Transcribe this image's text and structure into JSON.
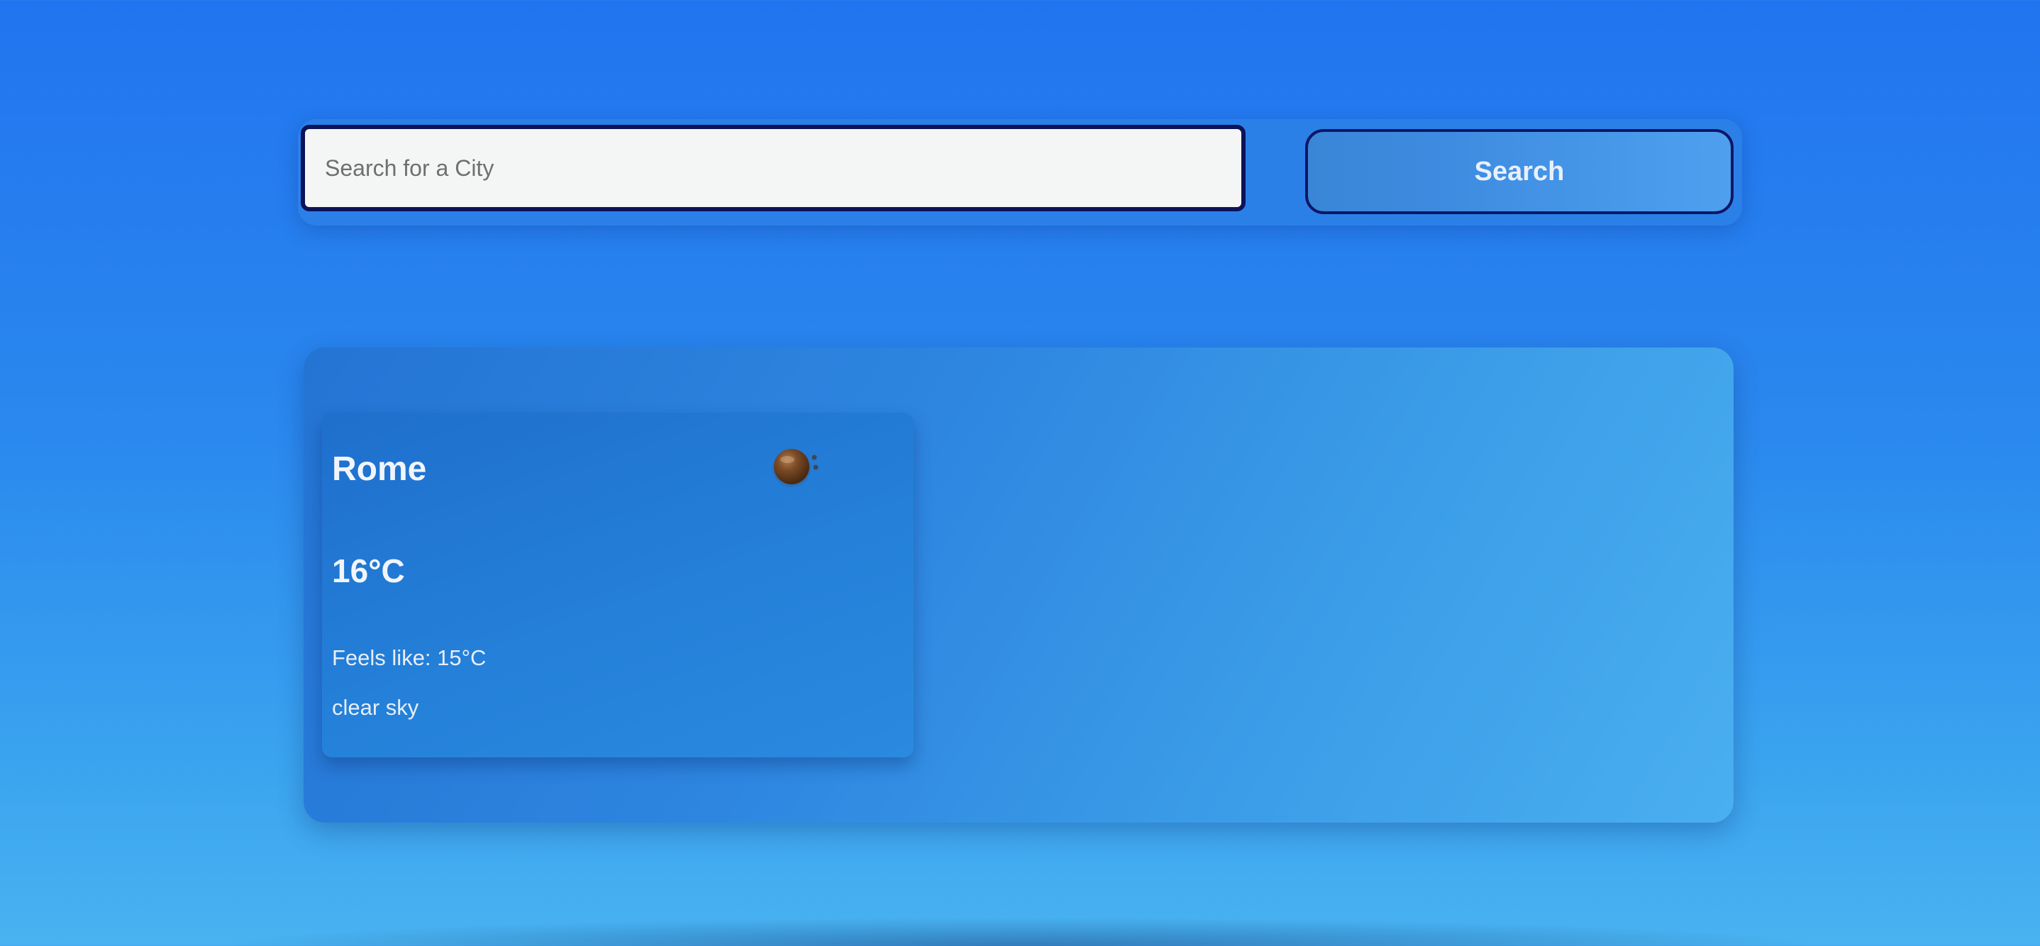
{
  "search": {
    "placeholder": "Search for a City",
    "value": "",
    "button_label": "Search"
  },
  "weather": {
    "city": "Rome",
    "temperature": "16°C",
    "feels_like_label": "Feels like: ",
    "feels_like_value": "15°C",
    "description": "clear sky",
    "icon": "clear-sky-icon"
  },
  "colors": {
    "background_top": "#2174ef",
    "background_bottom": "#49b2f0",
    "input_border": "#0c1459",
    "button_border": "#0d1766",
    "text_light": "#f1f5fb"
  }
}
